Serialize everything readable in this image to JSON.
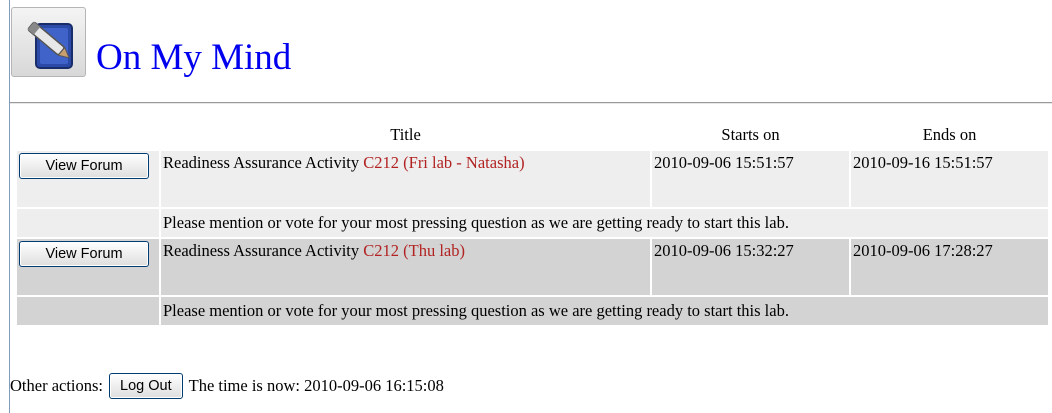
{
  "header": {
    "title": "On My Mind",
    "icon": "notepad-pencil-icon"
  },
  "table": {
    "columns": [
      "Title",
      "Starts on",
      "Ends on"
    ],
    "rows": [
      {
        "button_label": "View Forum",
        "title": "Readiness Assurance Activity",
        "course": "C212 (Fri lab - Natasha)",
        "starts_on": "2010-09-06 15:51:57",
        "ends_on": "2010-09-16 15:51:57",
        "description": "Please mention or vote for your most pressing question as we are getting ready to start this lab."
      },
      {
        "button_label": "View Forum",
        "title": "Readiness Assurance Activity",
        "course": "C212 (Thu lab)",
        "starts_on": "2010-09-06 15:32:27",
        "ends_on": "2010-09-06 17:28:27",
        "description": "Please mention or vote for your most pressing question as we are getting ready to start this lab."
      }
    ]
  },
  "footer": {
    "other_actions_label": "Other actions:",
    "logout_label": "Log Out",
    "time_label": "The time is now: 2010-09-06 16:15:08"
  },
  "colors": {
    "title": "#0000ee",
    "course": "#b22222",
    "row_light": "#eeeeee",
    "row_dark": "#d3d3d3"
  }
}
